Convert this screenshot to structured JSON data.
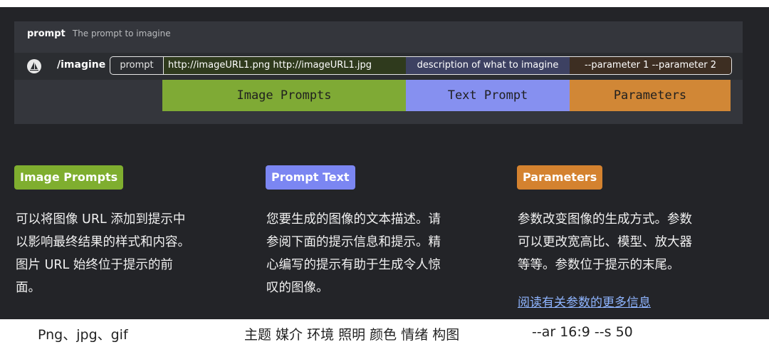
{
  "command": {
    "header_name": "prompt",
    "header_desc": "The prompt to imagine",
    "slash": "/imagine",
    "prompt_field": "prompt",
    "urls": "http://imageURL1.png  http://imageURL1.jpg",
    "text": "description of what to imagine",
    "params": "--parameter 1  --parameter 2"
  },
  "label_bars": {
    "image": "Image Prompts",
    "text": "Text Prompt",
    "params": "Parameters"
  },
  "sections": {
    "image": {
      "tag": "Image Prompts",
      "lines": [
        "可以将图像 URL 添加到提示中",
        "以影响最终结果的样式和内容。",
        "图片 URL 始终位于提示的前",
        "面。"
      ]
    },
    "text": {
      "tag": "Prompt Text",
      "lines": [
        "您要生成的图像的文本描述。请",
        "参阅下面的提示信息和提示。精",
        "心编写的提示有助于生成令人惊",
        "叹的图像。"
      ]
    },
    "params": {
      "tag": "Parameters",
      "lines": [
        "参数改变图像的生成方式。参数",
        "可以更改宽高比、模型、放大器",
        "等等。参数位于提示的末尾。"
      ],
      "link": "阅读有关参数的更多信息"
    }
  },
  "captions": {
    "image": "Png、jpg、gif",
    "text": "主题 媒介 环境 照明 颜色 情绪 构图",
    "params": "--ar 16:9 --s 50"
  },
  "colors": {
    "image": "#7faa35",
    "text": "#8690f0",
    "params": "#d18736",
    "link": "#8fb5ff"
  }
}
